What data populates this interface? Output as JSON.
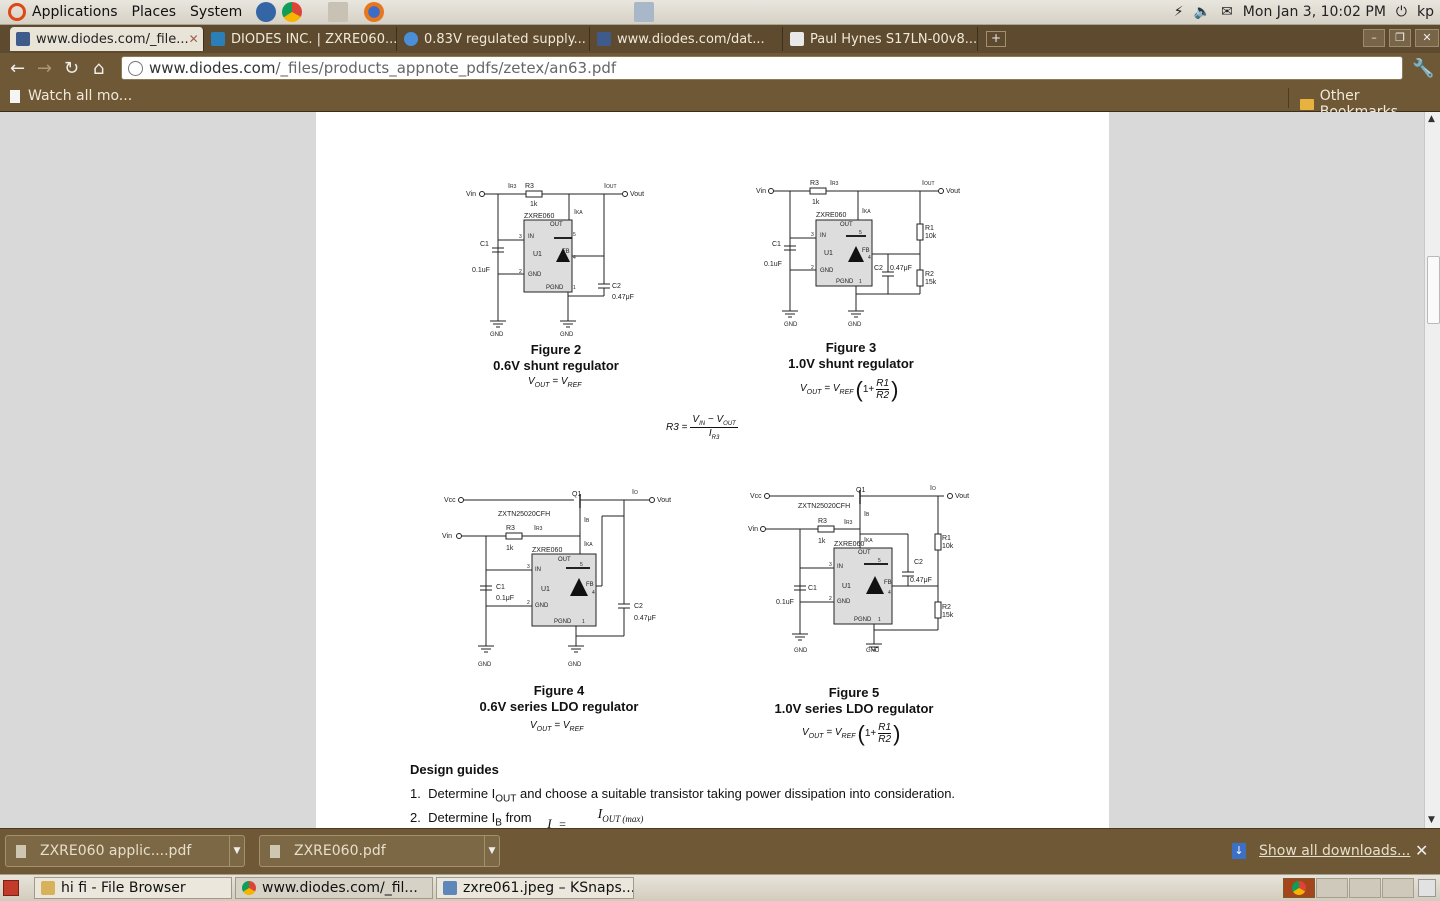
{
  "top_panel": {
    "menus": [
      "Applications",
      "Places",
      "System"
    ],
    "datetime": "Mon Jan  3, 10:02 PM",
    "user": "kp"
  },
  "tabs": [
    {
      "label": "www.diodes.com/_file...",
      "active": true
    },
    {
      "label": "DIODES INC. | ZXRE060...",
      "active": false
    },
    {
      "label": "0.83V regulated supply...",
      "active": false
    },
    {
      "label": "www.diodes.com/dat...",
      "active": false
    },
    {
      "label": "Paul Hynes S17LN-00v8...",
      "active": false
    }
  ],
  "toolbar": {
    "url_host": "www.diodes.com",
    "url_path": "/_files/products_appnote_pdfs/zetex/an63.pdf"
  },
  "bookmarks": {
    "left_item": "Watch all mo...",
    "other": "Other Bookmarks"
  },
  "pdf": {
    "fig2": {
      "name": "Figure 2",
      "caption": "0.6V shunt regulator"
    },
    "fig3": {
      "name": "Figure 3",
      "caption": "1.0V shunt regulator"
    },
    "fig4": {
      "name": "Figure 4",
      "caption": "0.6V series LDO regulator"
    },
    "fig5": {
      "name": "Figure 5",
      "caption": "1.0V series LDO regulator"
    },
    "circuit_labels": {
      "vin": "Vin",
      "vout": "Vout",
      "vcc": "Vcc",
      "r3": "R3",
      "r1": "R1",
      "r2": "R2",
      "c1": "C1",
      "c2": "C2",
      "ic": "ZXRE060",
      "u1": "U1",
      "gnd": "GND",
      "pgnd": "PGND",
      "in": "IN",
      "out": "OUT",
      "fb": "FB",
      "q1": "Q1",
      "transistor": "ZXTN25020CFH",
      "k1": "1k",
      "k10": "10k",
      "k15": "15k",
      "c1val": "0.1uF",
      "c1val_b": "0.1μF",
      "c2val": "0.47μF",
      "iout": "I",
      "iout_sub": "OUT",
      "ir3": "I",
      "ir3_sub": "R3",
      "ika": "I",
      "ika_sub": "KA",
      "ib": "I",
      "ib_sub": "B",
      "io": "I",
      "io_sub": "O",
      "pin3": "3",
      "pin2": "2",
      "pin5": "5",
      "pin4": "4",
      "pin1": "1"
    },
    "formula_r3": {
      "lhs": "R3 =",
      "num": "V",
      "num_sub1": "IN",
      "minus": " − V",
      "num_sub2": "OUT",
      "den": "I",
      "den_sub": "R3"
    },
    "formula_vout_lhs": "V",
    "formula_vout_sub": "OUT",
    "formula_eq": " = V",
    "formula_ref_sub": "REF",
    "formula_onep": "1+",
    "formula_r1": "R1",
    "formula_r2": "R2",
    "design_guides": "Design guides",
    "step1_num": "1.",
    "step1_a": "Determine I",
    "step1_sub": "OUT",
    "step1_b": " and choose a suitable transistor taking power dissipation into consideration.",
    "step2_num": "2.",
    "step2_a": "Determine I",
    "step2_sub": "B",
    "step2_b": " from",
    "step2_formula_lhs": "I",
    "step2_formula": "I",
    "step2_formula_sub": "OUT (max)"
  },
  "downloads": {
    "items": [
      "ZXRE060 applic....pdf",
      "ZXRE060.pdf"
    ],
    "show_all": "Show all downloads..."
  },
  "taskbar": {
    "items": [
      "hi fi  - File Browser",
      "www.diodes.com/_fil...",
      "zxre061.jpeg – KSnaps..."
    ]
  }
}
